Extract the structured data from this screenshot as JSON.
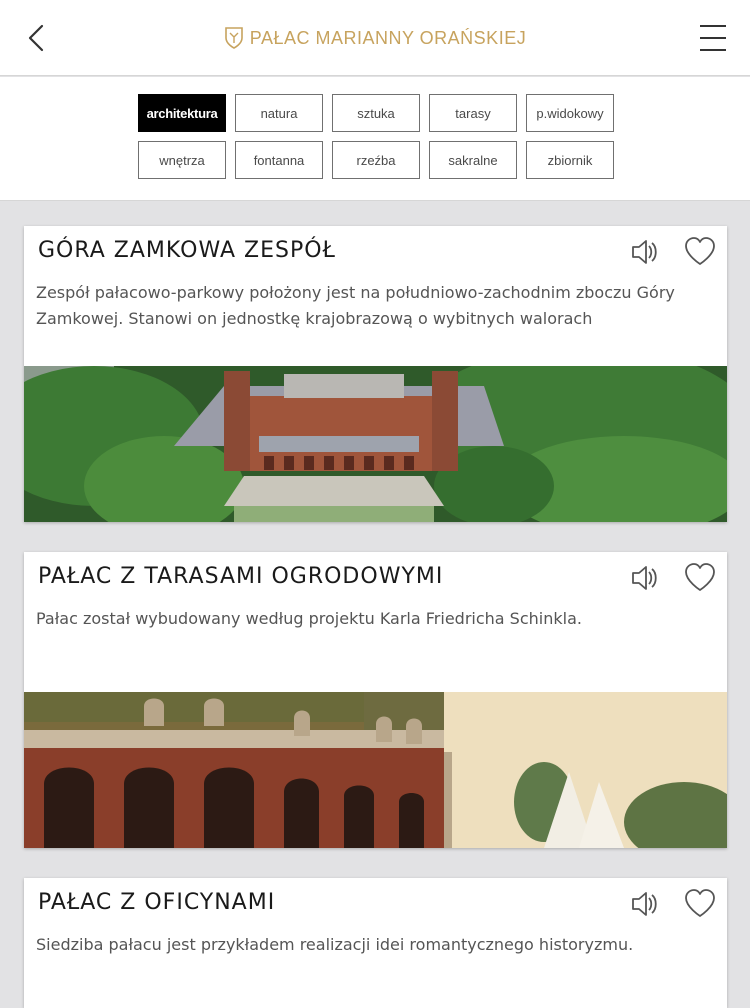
{
  "header": {
    "title": "PAŁAC MARIANNY ORAŃSKIEJ",
    "back_icon": "chevron-left-icon",
    "menu_icon": "hamburger-menu-icon",
    "brand_icon": "crest-icon",
    "accent_color": "#c7a35e"
  },
  "filters": [
    {
      "label": "architektura",
      "active": true
    },
    {
      "label": "natura",
      "active": false
    },
    {
      "label": "sztuka",
      "active": false
    },
    {
      "label": "tarasy",
      "active": false
    },
    {
      "label": "p.widokowy",
      "active": false
    },
    {
      "label": "wnętrza",
      "active": false
    },
    {
      "label": "fontanna",
      "active": false
    },
    {
      "label": "rzeźba",
      "active": false
    },
    {
      "label": "sakralne",
      "active": false
    },
    {
      "label": "zbiornik",
      "active": false
    }
  ],
  "cards": [
    {
      "title": "GÓRA ZAMKOWA ZESPÓŁ",
      "description": "Zespół pałacowo-parkowy położony jest na południowo-zachodnim zboczu Góry Zamkowej. Stanowi on jednostkę krajobrazową o wybitnych walorach",
      "audio_icon": "speaker-icon",
      "favorite_icon": "heart-icon"
    },
    {
      "title": "PAŁAC Z TARASAMI OGRODOWYMI",
      "description": "Pałac został wybudowany według projektu Karla Friedricha Schinkla.",
      "audio_icon": "speaker-icon",
      "favorite_icon": "heart-icon"
    },
    {
      "title": "PAŁAC Z OFICYNAMI",
      "description": "Siedziba pałacu jest przykładem realizacji idei romantycznego historyzmu.",
      "audio_icon": "speaker-icon",
      "favorite_icon": "heart-icon"
    }
  ]
}
